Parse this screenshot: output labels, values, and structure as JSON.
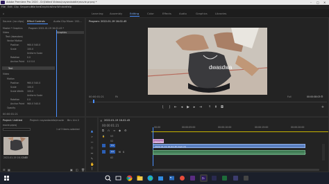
{
  "app": {
    "title": "Adobe Premiere Pro 2020 - D:\\Edited Videos\\nayandaddle\\movie.prproj *"
  },
  "menu": [
    "File",
    "Edit",
    "Clip",
    "Sequence",
    "Markers",
    "Graphics",
    "View",
    "Window",
    "Help"
  ],
  "workspaces": [
    "Learning",
    "Assembly",
    "Editing",
    "Color",
    "Effects",
    "Audio",
    "Graphics",
    "Libraries"
  ],
  "active_workspace": "Editing",
  "source_panel": {
    "tabs": [
      "Source: (no clips)",
      "Effect Controls",
      "Audio Clip Mixer: 202..."
    ],
    "active_tab": "Effect Controls",
    "master_label": "Master * Graphics",
    "sequence_label": "Program 2022-01-19 16-02-45 *",
    "header": "Graphics",
    "video_label": "Video",
    "rows": [
      {
        "label": "Text (dwasdwa)"
      },
      {
        "label": "Vector Motion"
      },
      {
        "label": "Position",
        "value": "960.0   540.0"
      },
      {
        "label": "Scale",
        "value": "100.0"
      },
      {
        "label": "Uniform Scale"
      },
      {
        "label": "Rotation",
        "value": "0.0"
      },
      {
        "label": "Anchor Point",
        "value": "0.0   0.0"
      },
      {
        "label": "Text"
      },
      {
        "label": "Motion"
      },
      {
        "label": "Position",
        "value": "960.0   540.0"
      },
      {
        "label": "Scale",
        "value": "100.0"
      },
      {
        "label": "Scale Width",
        "value": "100.0"
      },
      {
        "label": "Uniform Scale"
      },
      {
        "label": "Rotation",
        "value": "0.0"
      },
      {
        "label": "Anchor Point",
        "value": "960.0   540.0"
      },
      {
        "label": "Opacity"
      }
    ],
    "timecode": "00:00:01:21"
  },
  "program_monitor": {
    "title": "Program: 2022-01-19 16-02-45",
    "overlay_text": "dwasdwa",
    "current_timecode": "00:00:01:21",
    "fit": "Fit",
    "quality": "Full",
    "duration": "00:00:08:03"
  },
  "project_panel": {
    "tabs": [
      "Project: Untitled",
      "Project: nayandaddle/movie",
      "Bin: Uni 2"
    ],
    "file": "movie.prproj",
    "selection": "1 of 3 items selected",
    "thumb_label": "2022-01-19 16-02-45",
    "thumb_duration": "3:03"
  },
  "timeline": {
    "sequence_tab": "2022-01-19 16-02-45",
    "timecode": "00:00:01:21",
    "ruler": [
      "00:00",
      "00:00:05:00",
      "00:00:10:00",
      "00:00:15:00",
      "00:00:20:00"
    ],
    "tracks_v": [
      "V3",
      "V2",
      "V1"
    ],
    "tracks_a": [
      "A1",
      "A2"
    ],
    "graphic_clip": "dwasdwa",
    "video_clip": "2022-01-19 16-02-45.mp4 [V]"
  },
  "taskbar": {
    "icons": [
      "windows-icon",
      "search-icon",
      "taskview-icon",
      "chrome-icon",
      "explorer-icon",
      "edge-icon",
      "store-icon",
      "photos-icon",
      "app1-icon",
      "app2-icon",
      "premiere-icon",
      "app3-icon",
      "app4-icon",
      "app5-icon",
      "app6-icon"
    ]
  },
  "colors": {
    "accent": "#4a90ff",
    "playhead": "#4a90ff",
    "graphic_clip": "#b57ab8",
    "video_clip": "#5b7fc0",
    "audio_clip": "#3e7a52"
  }
}
